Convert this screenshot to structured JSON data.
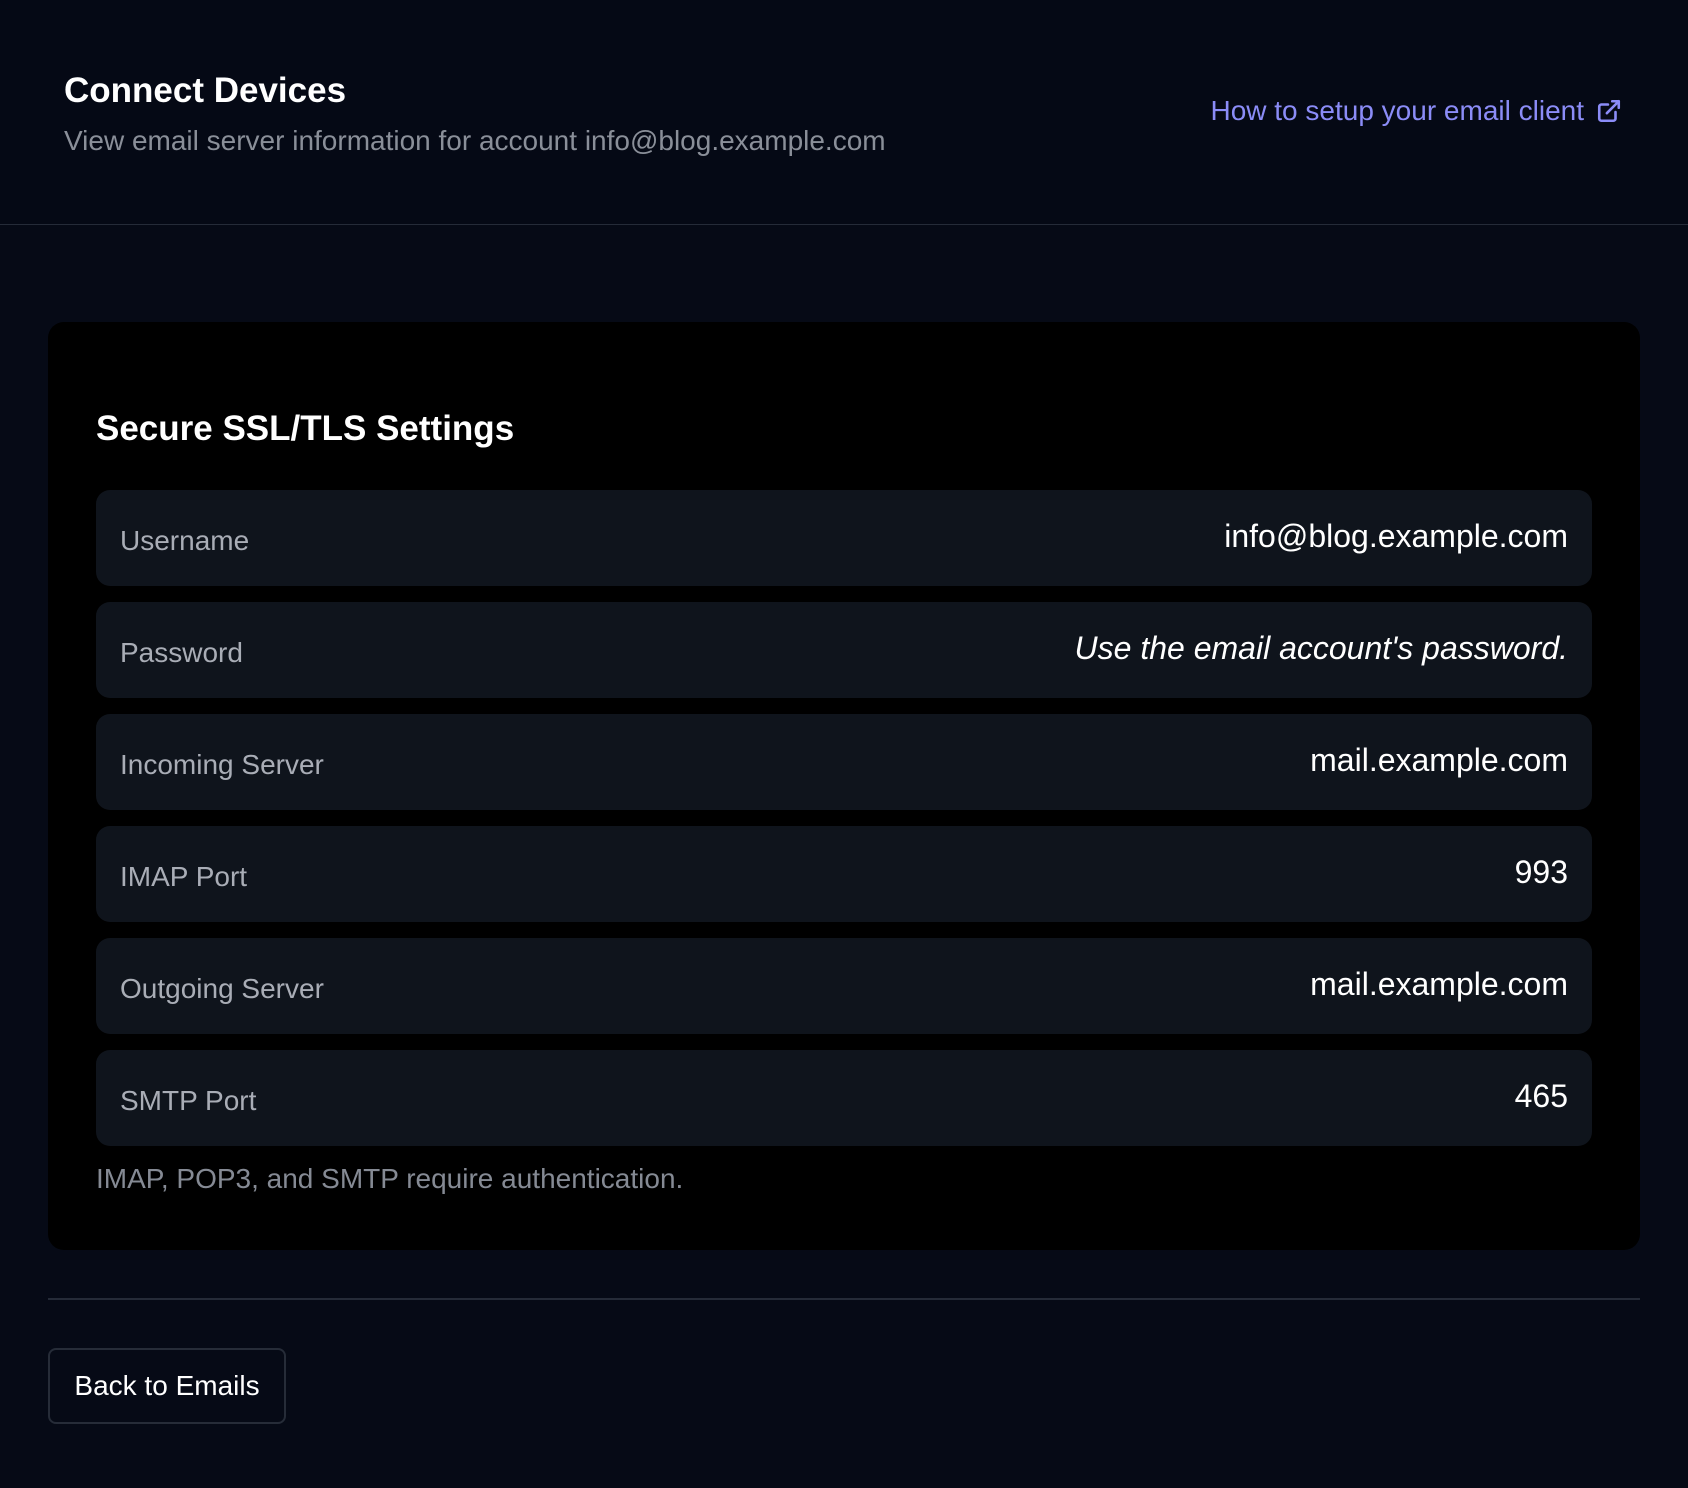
{
  "header": {
    "title": "Connect Devices",
    "subtitle": "View email server information for account info@blog.example.com",
    "help_link_label": "How to setup your email client",
    "help_link_icon": "external-link-icon"
  },
  "settings_card": {
    "title": "Secure SSL/TLS Settings",
    "rows": [
      {
        "label": "Username",
        "value": "info@blog.example.com"
      },
      {
        "label": "Password",
        "value": "Use the email account's password."
      },
      {
        "label": "Incoming Server",
        "value": "mail.example.com"
      },
      {
        "label": "IMAP Port",
        "value": "993"
      },
      {
        "label": "Outgoing Server",
        "value": "mail.example.com"
      },
      {
        "label": "SMTP Port",
        "value": "465"
      }
    ],
    "note": "IMAP, POP3, and SMTP require authentication."
  },
  "footer": {
    "back_button_label": "Back to Emails"
  },
  "colors": {
    "background": "#060a16",
    "card": "#000000",
    "row": "#0f141c",
    "link": "#8b8cf7",
    "muted_text": "#8a8f99"
  }
}
